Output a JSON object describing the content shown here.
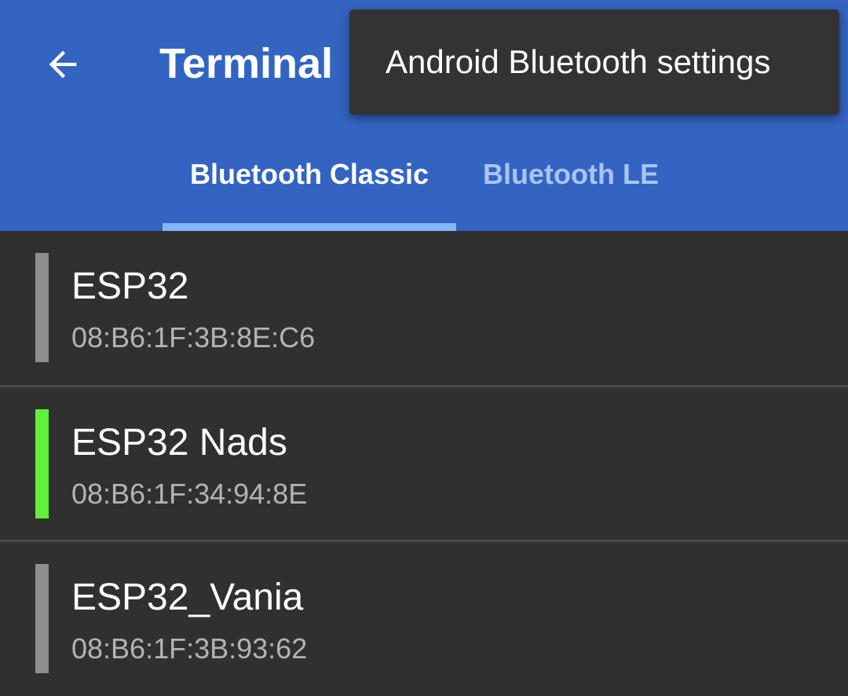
{
  "appbar": {
    "title": "Terminal",
    "back_icon": "arrow-left-icon"
  },
  "menu": {
    "items": [
      {
        "label": "Android Bluetooth settings"
      }
    ]
  },
  "tabs": [
    {
      "label": "Bluetooth Classic",
      "selected": true
    },
    {
      "label": "Bluetooth LE",
      "selected": false
    }
  ],
  "devices": [
    {
      "name": "ESP32",
      "address": "08:B6:1F:3B:8E:C6",
      "status_color": "#8E8E8E"
    },
    {
      "name": "ESP32 Nads",
      "address": "08:B6:1F:34:94:8E",
      "status_color": "#5EF03A"
    },
    {
      "name": "ESP32_Vania",
      "address": "08:B6:1F:3B:93:62",
      "status_color": "#8E8E8E"
    }
  ],
  "colors": {
    "primary": "#3364C2",
    "tab_indicator": "#86B5F5",
    "background": "#303030",
    "menu_background": "#333333",
    "connected": "#5EF03A",
    "disconnected": "#8E8E8E"
  }
}
